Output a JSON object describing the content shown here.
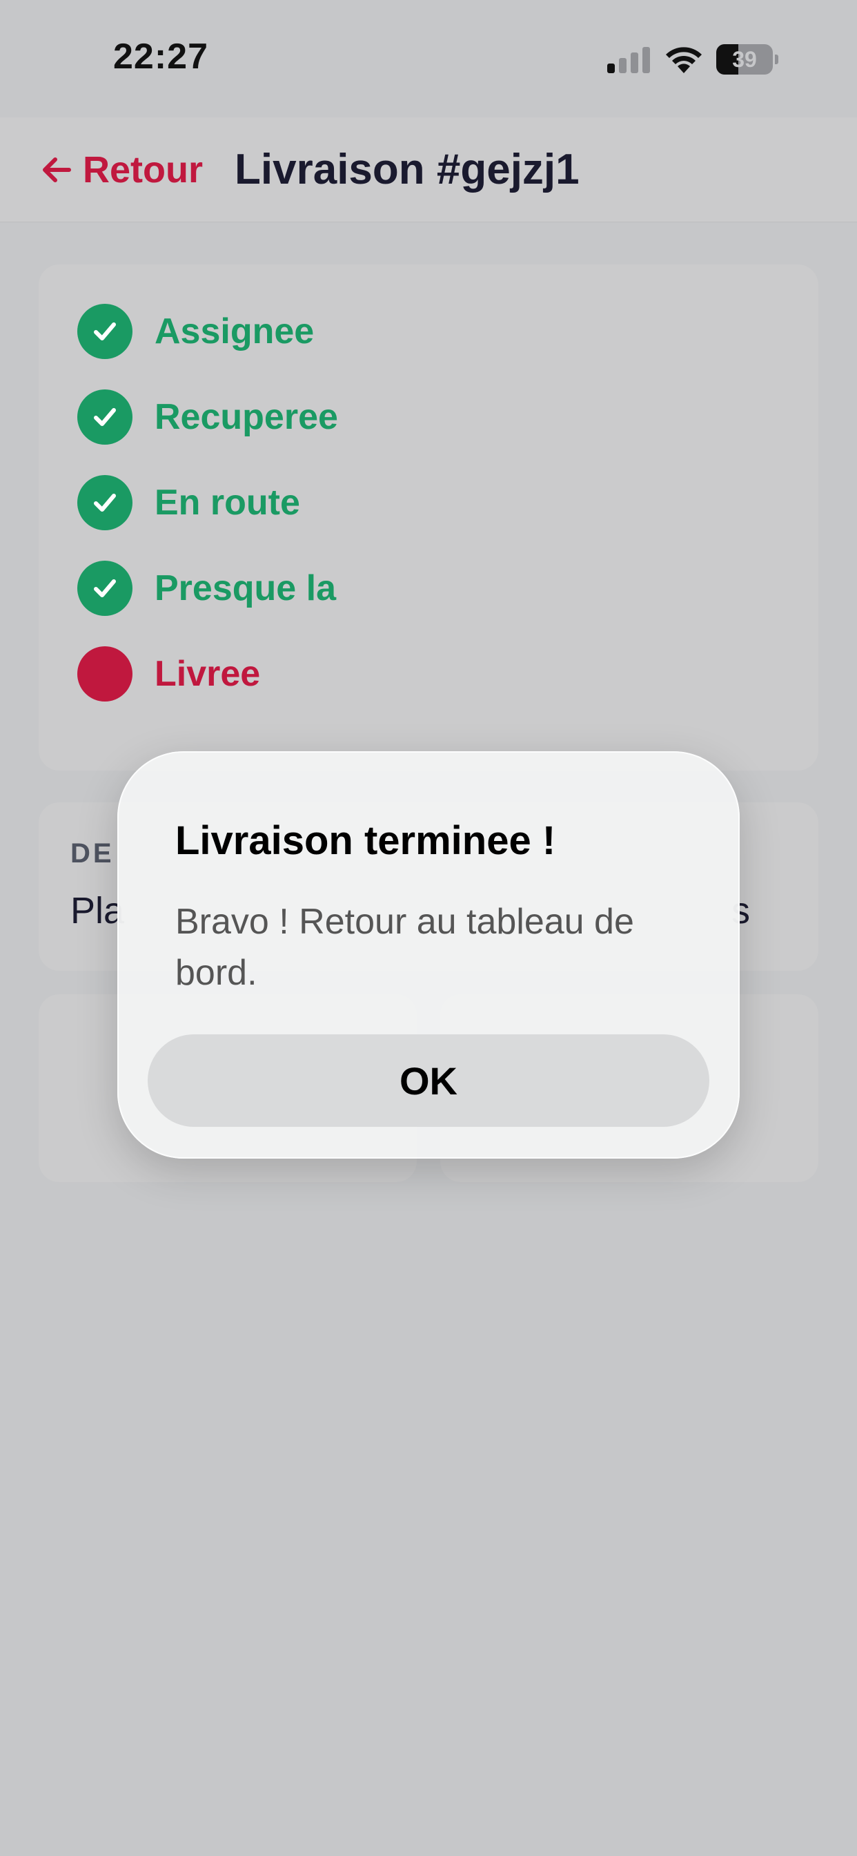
{
  "status_bar": {
    "time": "22:27",
    "battery_level": "39",
    "battery_fraction": 0.39,
    "signal_bars_active": 1,
    "signal_bars_total": 4
  },
  "header": {
    "back_label": "Retour",
    "title": "Livraison #gejzj1"
  },
  "timeline": {
    "steps": [
      {
        "label": "Assignee",
        "status": "done"
      },
      {
        "label": "Recuperee",
        "status": "done"
      },
      {
        "label": "En route",
        "status": "done"
      },
      {
        "label": "Presque la",
        "status": "done"
      },
      {
        "label": "Livree",
        "status": "current"
      }
    ]
  },
  "destination": {
    "label_visible": "DE",
    "value_start": "Pla",
    "value_end": "s"
  },
  "dialog": {
    "title": "Livraison terminee !",
    "message": "Bravo ! Retour au tableau de bord.",
    "ok_label": "OK"
  },
  "colors": {
    "accent": "#c0183e",
    "success": "#1a9a63",
    "title": "#1a1a2e",
    "backdrop": "#c6c7c9"
  },
  "icons": {
    "back": "arrow-left-icon",
    "done": "check-icon",
    "message_action": "message-icon",
    "call_action": "phone-icon"
  }
}
